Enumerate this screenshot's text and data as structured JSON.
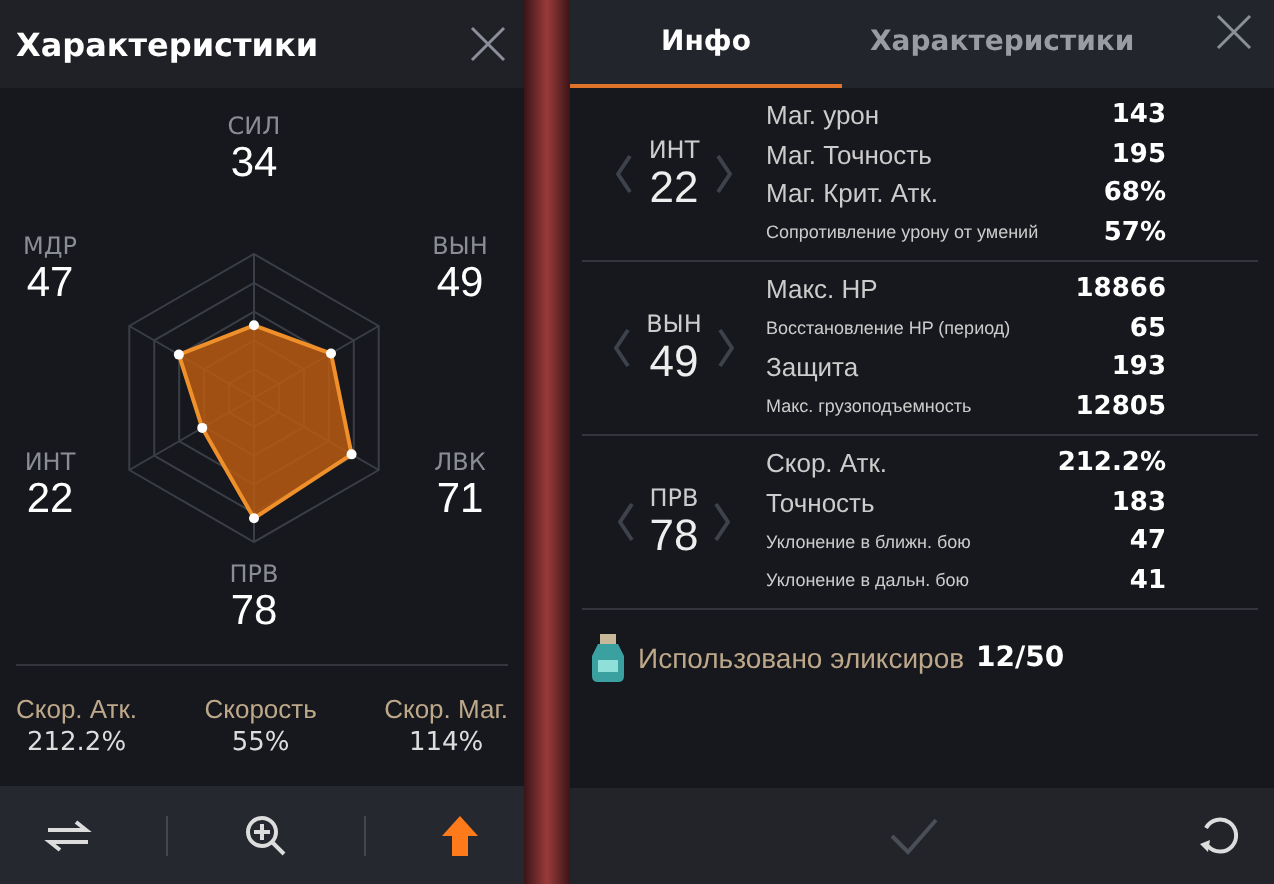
{
  "left_panel": {
    "title": "Характеристики",
    "stats": [
      {
        "label": "СИЛ",
        "value": "34"
      },
      {
        "label": "ВЫН",
        "value": "49"
      },
      {
        "label": "ЛВК",
        "value": "71"
      },
      {
        "label": "ПРВ",
        "value": "78"
      },
      {
        "label": "ИНТ",
        "value": "22"
      },
      {
        "label": "МДР",
        "value": "47"
      }
    ],
    "speeds": [
      {
        "label": "Скор. Атк.",
        "value": "212.2%"
      },
      {
        "label": "Скорость",
        "value": "55%"
      },
      {
        "label": "Скор. Маг.",
        "value": "114%"
      }
    ]
  },
  "right_panel": {
    "tabs": [
      {
        "label": "Инфо",
        "selected": true
      },
      {
        "label": "Характеристики",
        "selected": false
      }
    ],
    "groups": [
      {
        "stat": "ИНТ",
        "value": "22",
        "rows": [
          {
            "label": "Маг. урон",
            "value": "143",
            "small": false
          },
          {
            "label": "Маг. Точность",
            "value": "195",
            "small": false
          },
          {
            "label": "Маг. Крит. Атк.",
            "value": "68%",
            "small": false
          },
          {
            "label": "Сопротивление урону от умений",
            "value": "57%",
            "small": true
          }
        ]
      },
      {
        "stat": "ВЫН",
        "value": "49",
        "rows": [
          {
            "label": "Макс. HP",
            "value": "18866",
            "small": false
          },
          {
            "label": "Восстановление HP (период)",
            "value": "65",
            "small": true
          },
          {
            "label": "Защита",
            "value": "193",
            "small": false
          },
          {
            "label": "Макс. грузоподъемность",
            "value": "12805",
            "small": true
          }
        ]
      },
      {
        "stat": "ПРВ",
        "value": "78",
        "rows": [
          {
            "label": "Скор. Атк.",
            "value": "212.2%",
            "small": false
          },
          {
            "label": "Точность",
            "value": "183",
            "small": false
          },
          {
            "label": "Уклонение в ближн. бою",
            "value": "47",
            "small": true
          },
          {
            "label": "Уклонение в дальн. бою",
            "value": "41",
            "small": true
          }
        ]
      }
    ],
    "elixirs": {
      "label": "Использовано эликсиров",
      "value": "12/50"
    },
    "confirm_disabled": true
  }
}
